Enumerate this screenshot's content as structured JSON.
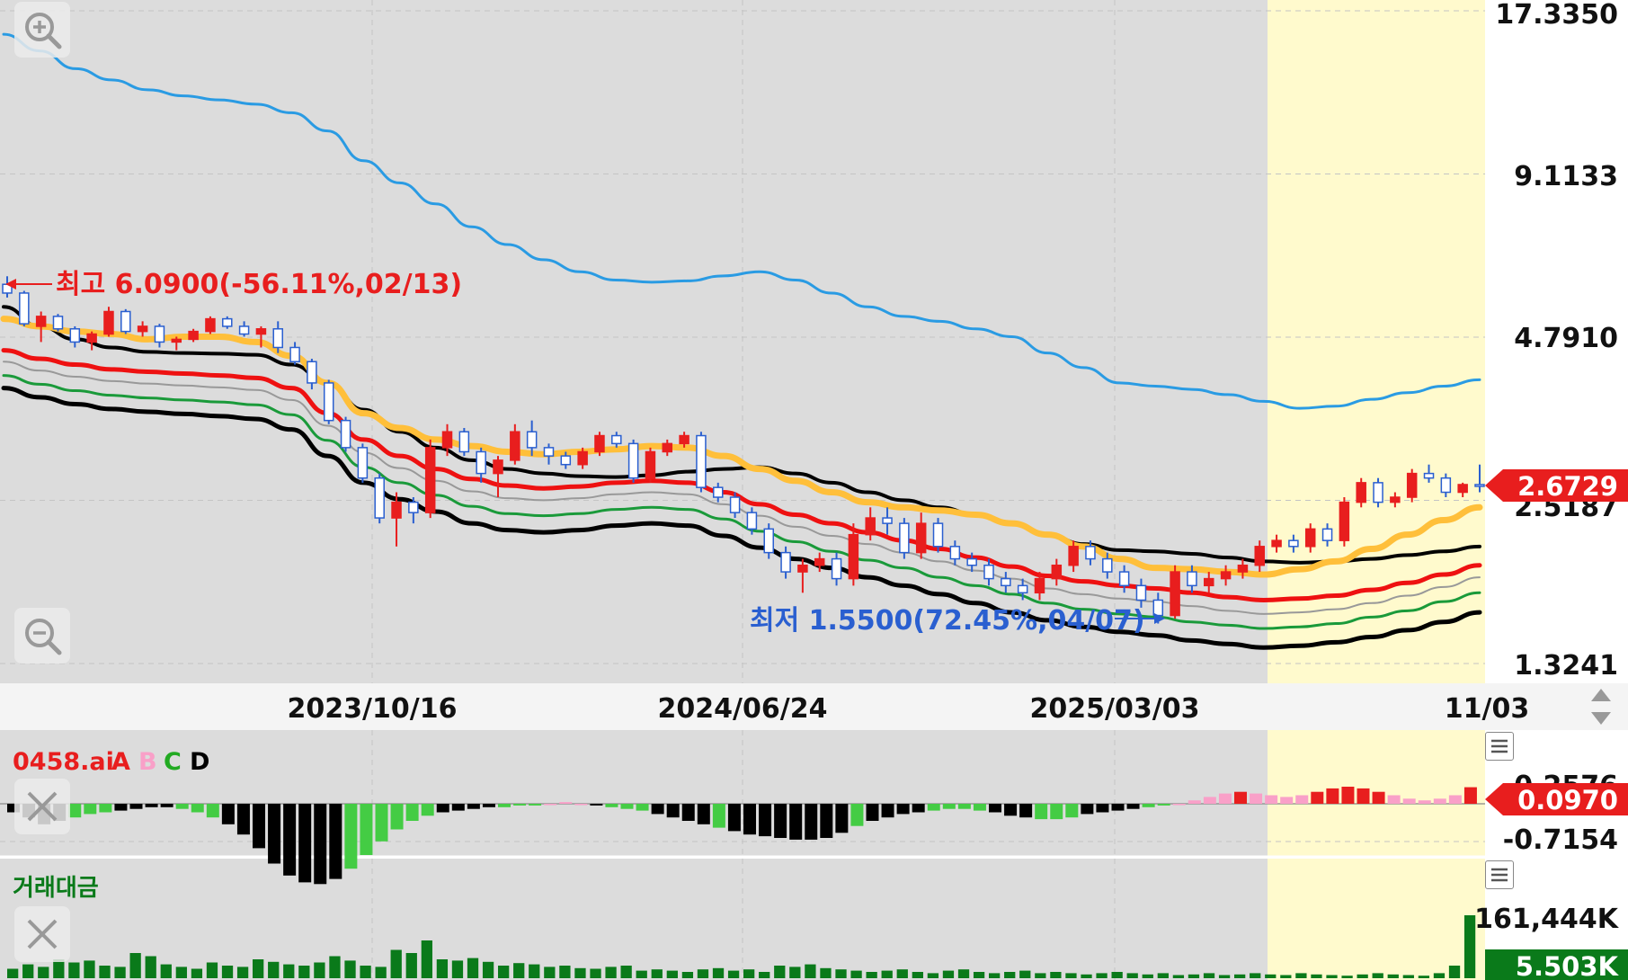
{
  "chart_data": [
    {
      "type": "candlestick",
      "panel": "price",
      "x_ticks": [
        "2023/10/16",
        "2024/06/24",
        "2025/03/03",
        "11/03"
      ],
      "y_ticks": [
        "17.3350",
        "9.1133",
        "4.7910",
        "2.5187",
        "1.3241"
      ],
      "y_scale": "log",
      "ylim": [
        1.3241,
        17.335
      ],
      "current_price": "2.6729",
      "high_annotation": "최고 6.0900(-56.11%,02/13)",
      "low_annotation": "최저 1.5500(72.45%,04/07)",
      "highlight_region": "last ~17% of x-axis (yellow)",
      "series": [
        {
          "name": "upper-blue",
          "color": "#2a9be3",
          "values": [
            15.8,
            14.8,
            13.8,
            13.2,
            12.7,
            12.4,
            12.2,
            12.0,
            11.6,
            10.8,
            9.6,
            8.8,
            8.1,
            7.4,
            6.9,
            6.5,
            6.2,
            6.0,
            5.95,
            5.98,
            6.1,
            6.2,
            6.0,
            5.7,
            5.4,
            5.2,
            5.1,
            4.95,
            4.8,
            4.5,
            4.25,
            4.0,
            3.95,
            3.9,
            3.82,
            3.72,
            3.62,
            3.65,
            3.75,
            3.85,
            3.95,
            4.05
          ]
        },
        {
          "name": "upper-black",
          "color": "#000000",
          "values": [
            5.4,
            5.0,
            4.75,
            4.6,
            4.52,
            4.5,
            4.49,
            4.47,
            4.3,
            4.0,
            3.6,
            3.3,
            3.1,
            2.95,
            2.85,
            2.8,
            2.77,
            2.76,
            2.78,
            2.82,
            2.85,
            2.87,
            2.8,
            2.7,
            2.6,
            2.52,
            2.45,
            2.38,
            2.3,
            2.2,
            2.12,
            2.07,
            2.06,
            2.04,
            2.01,
            1.98,
            1.97,
            1.98,
            2.0,
            2.03,
            2.06,
            2.1
          ]
        },
        {
          "name": "ma-yellow",
          "color": "#ffbf3a",
          "values": [
            5.15,
            5.0,
            4.9,
            4.85,
            4.75,
            4.8,
            4.8,
            4.7,
            4.45,
            4.0,
            3.55,
            3.35,
            3.2,
            3.12,
            3.05,
            3.02,
            3.05,
            3.08,
            3.12,
            3.1,
            3.0,
            2.85,
            2.72,
            2.6,
            2.5,
            2.45,
            2.42,
            2.38,
            2.3,
            2.2,
            2.1,
            2.0,
            1.93,
            1.92,
            1.9,
            1.88,
            1.92,
            1.98,
            2.08,
            2.2,
            2.33,
            2.45
          ]
        },
        {
          "name": "mid-red",
          "color": "#ee1111",
          "values": [
            4.55,
            4.4,
            4.3,
            4.22,
            4.18,
            4.15,
            4.12,
            4.08,
            3.92,
            3.55,
            3.2,
            3.0,
            2.85,
            2.74,
            2.67,
            2.64,
            2.66,
            2.7,
            2.72,
            2.7,
            2.6,
            2.48,
            2.38,
            2.3,
            2.22,
            2.15,
            2.08,
            2.01,
            1.94,
            1.87,
            1.83,
            1.8,
            1.78,
            1.75,
            1.72,
            1.7,
            1.71,
            1.73,
            1.77,
            1.82,
            1.88,
            1.95
          ]
        },
        {
          "name": "band-gray",
          "color": "#999999",
          "values": [
            4.35,
            4.2,
            4.1,
            4.03,
            3.99,
            3.96,
            3.93,
            3.89,
            3.74,
            3.38,
            3.04,
            2.86,
            2.72,
            2.61,
            2.54,
            2.52,
            2.54,
            2.58,
            2.6,
            2.58,
            2.48,
            2.37,
            2.27,
            2.19,
            2.12,
            2.05,
            1.98,
            1.91,
            1.85,
            1.78,
            1.74,
            1.71,
            1.69,
            1.66,
            1.63,
            1.61,
            1.62,
            1.64,
            1.68,
            1.73,
            1.79,
            1.86
          ]
        },
        {
          "name": "band-green",
          "color": "#1a9a3a",
          "values": [
            4.12,
            3.98,
            3.88,
            3.81,
            3.77,
            3.74,
            3.71,
            3.67,
            3.53,
            3.19,
            2.87,
            2.7,
            2.57,
            2.46,
            2.39,
            2.37,
            2.39,
            2.43,
            2.45,
            2.43,
            2.34,
            2.23,
            2.14,
            2.06,
            1.99,
            1.93,
            1.86,
            1.8,
            1.74,
            1.68,
            1.64,
            1.61,
            1.59,
            1.56,
            1.54,
            1.52,
            1.53,
            1.55,
            1.59,
            1.63,
            1.69,
            1.75
          ]
        },
        {
          "name": "lower-black",
          "color": "#000000",
          "values": [
            3.92,
            3.78,
            3.68,
            3.61,
            3.57,
            3.54,
            3.51,
            3.47,
            3.33,
            3.0,
            2.7,
            2.53,
            2.41,
            2.3,
            2.24,
            2.22,
            2.24,
            2.28,
            2.3,
            2.28,
            2.19,
            2.09,
            2.0,
            1.93,
            1.86,
            1.8,
            1.74,
            1.68,
            1.62,
            1.57,
            1.53,
            1.5,
            1.48,
            1.45,
            1.43,
            1.41,
            1.42,
            1.44,
            1.47,
            1.51,
            1.56,
            1.62
          ]
        }
      ],
      "candles": [
        [
          5.9,
          6.09,
          5.6,
          5.7
        ],
        [
          5.7,
          5.75,
          5.0,
          5.05
        ],
        [
          5.0,
          5.3,
          4.7,
          5.2
        ],
        [
          5.2,
          5.25,
          4.9,
          4.95
        ],
        [
          4.95,
          5.0,
          4.6,
          4.7
        ],
        [
          4.7,
          4.9,
          4.55,
          4.85
        ],
        [
          4.85,
          5.4,
          4.8,
          5.3
        ],
        [
          5.3,
          5.35,
          4.85,
          4.9
        ],
        [
          4.9,
          5.1,
          4.8,
          5.0
        ],
        [
          5.0,
          5.05,
          4.6,
          4.7
        ],
        [
          4.7,
          4.8,
          4.55,
          4.75
        ],
        [
          4.75,
          4.95,
          4.7,
          4.9
        ],
        [
          4.9,
          5.2,
          4.85,
          5.15
        ],
        [
          5.15,
          5.2,
          4.95,
          5.0
        ],
        [
          5.0,
          5.1,
          4.8,
          4.85
        ],
        [
          4.85,
          5.0,
          4.6,
          4.95
        ],
        [
          4.95,
          5.1,
          4.5,
          4.6
        ],
        [
          4.6,
          4.7,
          4.3,
          4.35
        ],
        [
          4.35,
          4.4,
          3.9,
          4.0
        ],
        [
          4.0,
          4.05,
          3.4,
          3.45
        ],
        [
          3.45,
          3.5,
          3.05,
          3.1
        ],
        [
          3.1,
          3.15,
          2.7,
          2.75
        ],
        [
          2.75,
          2.8,
          2.3,
          2.35
        ],
        [
          2.35,
          2.6,
          2.1,
          2.5
        ],
        [
          2.5,
          2.55,
          2.3,
          2.4
        ],
        [
          2.4,
          3.2,
          2.35,
          3.1
        ],
        [
          3.1,
          3.4,
          3.0,
          3.3
        ],
        [
          3.3,
          3.35,
          3.0,
          3.05
        ],
        [
          3.05,
          3.1,
          2.7,
          2.8
        ],
        [
          2.8,
          3.0,
          2.55,
          2.95
        ],
        [
          2.95,
          3.4,
          2.9,
          3.3
        ],
        [
          3.3,
          3.45,
          3.0,
          3.1
        ],
        [
          3.1,
          3.15,
          2.9,
          3.0
        ],
        [
          3.0,
          3.05,
          2.85,
          2.9
        ],
        [
          2.9,
          3.1,
          2.85,
          3.05
        ],
        [
          3.05,
          3.3,
          3.0,
          3.25
        ],
        [
          3.25,
          3.3,
          3.1,
          3.15
        ],
        [
          3.15,
          3.2,
          2.7,
          2.75
        ],
        [
          2.75,
          3.1,
          2.7,
          3.05
        ],
        [
          3.05,
          3.2,
          3.0,
          3.15
        ],
        [
          3.15,
          3.3,
          3.1,
          3.25
        ],
        [
          3.25,
          3.3,
          2.6,
          2.65
        ],
        [
          2.65,
          2.7,
          2.5,
          2.55
        ],
        [
          2.55,
          2.6,
          2.35,
          2.4
        ],
        [
          2.4,
          2.45,
          2.2,
          2.25
        ],
        [
          2.25,
          2.3,
          2.0,
          2.05
        ],
        [
          2.05,
          2.1,
          1.85,
          1.9
        ],
        [
          1.9,
          2.0,
          1.75,
          1.95
        ],
        [
          1.95,
          2.05,
          1.9,
          2.0
        ],
        [
          2.0,
          2.05,
          1.8,
          1.85
        ],
        [
          1.85,
          2.3,
          1.8,
          2.2
        ],
        [
          2.2,
          2.45,
          2.15,
          2.35
        ],
        [
          2.35,
          2.45,
          2.2,
          2.3
        ],
        [
          2.3,
          2.35,
          2.0,
          2.05
        ],
        [
          2.05,
          2.4,
          2.0,
          2.3
        ],
        [
          2.3,
          2.35,
          2.05,
          2.1
        ],
        [
          2.1,
          2.15,
          1.95,
          2.0
        ],
        [
          2.0,
          2.05,
          1.9,
          1.95
        ],
        [
          1.95,
          2.0,
          1.8,
          1.85
        ],
        [
          1.85,
          1.9,
          1.75,
          1.8
        ],
        [
          1.8,
          1.85,
          1.7,
          1.75
        ],
        [
          1.75,
          1.9,
          1.7,
          1.85
        ],
        [
          1.85,
          2.0,
          1.8,
          1.95
        ],
        [
          1.95,
          2.15,
          1.9,
          2.1
        ],
        [
          2.1,
          2.15,
          1.95,
          2.0
        ],
        [
          2.0,
          2.05,
          1.85,
          1.9
        ],
        [
          1.9,
          1.95,
          1.75,
          1.8
        ],
        [
          1.8,
          1.85,
          1.65,
          1.7
        ],
        [
          1.7,
          1.75,
          1.55,
          1.6
        ],
        [
          1.6,
          1.95,
          1.58,
          1.9
        ],
        [
          1.9,
          1.95,
          1.75,
          1.8
        ],
        [
          1.8,
          1.9,
          1.75,
          1.85
        ],
        [
          1.85,
          1.95,
          1.8,
          1.9
        ],
        [
          1.9,
          2.0,
          1.85,
          1.95
        ],
        [
          1.95,
          2.15,
          1.9,
          2.1
        ],
        [
          2.1,
          2.2,
          2.05,
          2.15
        ],
        [
          2.15,
          2.2,
          2.05,
          2.1
        ],
        [
          2.1,
          2.3,
          2.05,
          2.25
        ],
        [
          2.25,
          2.3,
          2.1,
          2.15
        ],
        [
          2.15,
          2.55,
          2.1,
          2.5
        ],
        [
          2.5,
          2.75,
          2.45,
          2.7
        ],
        [
          2.7,
          2.75,
          2.45,
          2.5
        ],
        [
          2.5,
          2.6,
          2.45,
          2.55
        ],
        [
          2.55,
          2.85,
          2.5,
          2.8
        ],
        [
          2.8,
          2.9,
          2.7,
          2.75
        ],
        [
          2.75,
          2.8,
          2.55,
          2.6
        ],
        [
          2.6,
          2.7,
          2.55,
          2.68
        ],
        [
          2.68,
          2.9,
          2.6,
          2.6729
        ]
      ]
    },
    {
      "type": "bar",
      "panel": "oscillator",
      "legend": [
        "0458.ai",
        "A",
        "B",
        "C",
        "D"
      ],
      "y_ticks": [
        "0.2576",
        "-0.7154"
      ],
      "current_value": "0.0970",
      "values": [
        -0.05,
        -0.08,
        -0.12,
        -0.1,
        -0.08,
        -0.06,
        -0.05,
        -0.04,
        -0.03,
        -0.02,
        -0.02,
        -0.03,
        -0.05,
        -0.08,
        -0.12,
        -0.18,
        -0.26,
        -0.35,
        -0.42,
        -0.46,
        -0.47,
        -0.44,
        -0.38,
        -0.3,
        -0.22,
        -0.15,
        -0.1,
        -0.07,
        -0.05,
        -0.04,
        -0.03,
        -0.02,
        -0.02,
        -0.01,
        -0.01,
        0.0,
        0.01,
        0.0,
        -0.01,
        -0.02,
        -0.03,
        -0.04,
        -0.06,
        -0.08,
        -0.1,
        -0.12,
        -0.14,
        -0.16,
        -0.18,
        -0.19,
        -0.2,
        -0.21,
        -0.21,
        -0.2,
        -0.17,
        -0.13,
        -0.1,
        -0.08,
        -0.06,
        -0.05,
        -0.04,
        -0.03,
        -0.03,
        -0.04,
        -0.05,
        -0.07,
        -0.08,
        -0.09,
        -0.09,
        -0.08,
        -0.06,
        -0.05,
        -0.04,
        -0.03,
        -0.02,
        -0.01,
        0.0,
        0.02,
        0.04,
        0.06,
        0.07,
        0.06,
        0.05,
        0.04,
        0.05,
        0.07,
        0.09,
        0.1,
        0.09,
        0.07,
        0.05,
        0.03,
        0.02,
        0.03,
        0.05,
        0.097
      ]
    },
    {
      "type": "bar",
      "panel": "volume",
      "legend": [
        "거래대금"
      ],
      "y_ticks": [
        "161,444K"
      ],
      "current_value": "5.503K",
      "values": [
        15,
        22,
        18,
        30,
        25,
        28,
        20,
        18,
        40,
        35,
        22,
        18,
        15,
        25,
        20,
        18,
        30,
        26,
        22,
        20,
        25,
        35,
        28,
        20,
        18,
        45,
        40,
        60,
        30,
        28,
        32,
        26,
        20,
        24,
        22,
        18,
        20,
        16,
        15,
        18,
        20,
        12,
        14,
        12,
        10,
        14,
        16,
        12,
        14,
        10,
        20,
        18,
        22,
        16,
        14,
        12,
        10,
        12,
        14,
        10,
        8,
        12,
        14,
        10,
        8,
        10,
        12,
        8,
        10,
        8,
        6,
        8,
        10,
        8,
        6,
        8,
        5,
        6,
        8,
        5,
        6,
        8,
        6,
        5,
        8,
        6,
        5,
        4,
        6,
        8,
        6,
        5,
        4,
        8,
        20,
        100
      ]
    }
  ],
  "ui": {
    "zoom_in_label": "zoom in",
    "zoom_out_label": "zoom out",
    "close_label": "close indicator",
    "menu_label": "indicator menu",
    "scroll_label": "scroll axis"
  },
  "colors": {
    "panel_bg": "#dcdcdc",
    "highlight_bg": "#fffacd",
    "up": "#e81e1e",
    "down": "#2a5fd0",
    "price_badge": "#e81e1e",
    "volume_badge": "#0a7a1a",
    "volume_bar": "#0a7a1a",
    "osc_red": "#e81e1e",
    "osc_pink": "#f9a0c8",
    "osc_green": "#44cc44",
    "osc_black": "#000000"
  }
}
